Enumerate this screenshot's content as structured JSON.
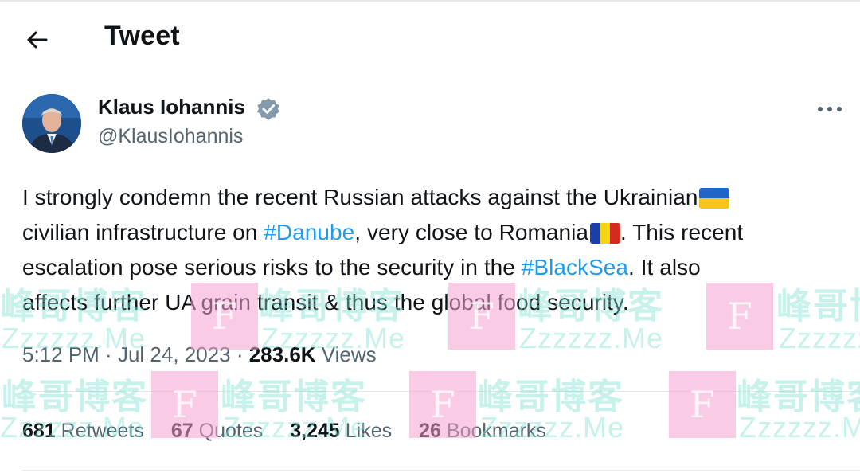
{
  "header": {
    "title": "Tweet"
  },
  "author": {
    "name": "Klaus Iohannis",
    "handle": "@KlausIohannis"
  },
  "tweet": {
    "line1": "I strongly condemn the recent Russian attacks against the Ukrainian",
    "line2_a": "civilian infrastructure on ",
    "line2_tag": "#Danube",
    "line2_b": ", very close to Romania",
    "line2_c": ". This recent",
    "line3_a": "escalation pose serious risks to the security in the ",
    "line3_tag": "#BlackSea",
    "line3_b": ". It also",
    "line4": "affects further UA grain transit & thus the global food security."
  },
  "meta": {
    "time": "5:12 PM",
    "sep1": " · ",
    "date": "Jul 24, 2023",
    "sep2": " · ",
    "views_count": "283.6K",
    "views_label": " Views"
  },
  "stats": {
    "retweets_count": "681",
    "retweets_label": " Retweets",
    "quotes_count": "67",
    "quotes_label": " Quotes",
    "likes_count": "3,245",
    "likes_label": " Likes",
    "bookmarks_count": "26",
    "bookmarks_label": " Bookmarks"
  },
  "watermark": {
    "letter": "F",
    "cn": "峰哥博客",
    "en": "Zzzzzz.Me"
  },
  "colors": {
    "link": "#1d9bf0",
    "secondary": "#536471",
    "text": "#0f1419",
    "verified": "#829aab"
  }
}
